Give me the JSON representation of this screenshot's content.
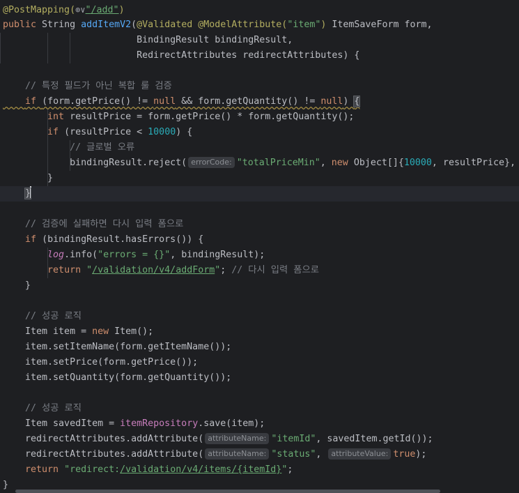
{
  "editor": {
    "lines": [
      {
        "segments": [
          {
            "t": "@PostMapping(",
            "c": "ann"
          },
          {
            "icon": "globe-icon"
          },
          {
            "t": "\"/add\"",
            "c": "url"
          },
          {
            "t": ")",
            "c": "ann"
          }
        ]
      },
      {
        "segments": [
          {
            "t": "public ",
            "c": "kw"
          },
          {
            "t": "String "
          },
          {
            "t": "addItemV2",
            "c": "fn"
          },
          {
            "t": "("
          },
          {
            "t": "@Validated @ModelAttribute(",
            "c": "ann"
          },
          {
            "t": "\"item\"",
            "c": "str"
          },
          {
            "t": ")",
            "c": "ann"
          },
          {
            "t": " ItemSaveForm form,"
          }
        ]
      },
      {
        "segments": [
          {
            "t": "                        BindingResult bindingResult,"
          }
        ]
      },
      {
        "segments": [
          {
            "t": "                        RedirectAttributes redirectAttributes) {"
          }
        ]
      },
      {
        "segments": [
          {
            "t": ""
          }
        ]
      },
      {
        "segments": [
          {
            "t": "    "
          },
          {
            "t": "// 특정 필드가 아닌 복합 룰 검증",
            "c": "cmt"
          }
        ]
      },
      {
        "warn": true,
        "segments": [
          {
            "t": "    "
          },
          {
            "t": "if ",
            "c": "kw"
          },
          {
            "t": "(form.getPrice() != "
          },
          {
            "t": "null",
            "c": "kw"
          },
          {
            "t": " && form.getQuantity() != "
          },
          {
            "t": "null",
            "c": "kw"
          },
          {
            "t": ") "
          },
          {
            "t": "{",
            "c": "brace"
          }
        ]
      },
      {
        "segments": [
          {
            "t": "        "
          },
          {
            "t": "int ",
            "c": "kw"
          },
          {
            "t": "resultPrice = form.getPrice() * form.getQuantity();"
          }
        ]
      },
      {
        "segments": [
          {
            "t": "        "
          },
          {
            "t": "if ",
            "c": "kw"
          },
          {
            "t": "(resultPrice < "
          },
          {
            "t": "10000",
            "c": "num"
          },
          {
            "t": ") {"
          }
        ]
      },
      {
        "segments": [
          {
            "t": "            "
          },
          {
            "t": "// 글로벌 오류",
            "c": "cmt"
          }
        ]
      },
      {
        "segments": [
          {
            "t": "            bindingResult.reject("
          },
          {
            "hint": "errorCode:"
          },
          {
            "t": "\"totalPriceMin\"",
            "c": "str"
          },
          {
            "t": ", "
          },
          {
            "t": "new ",
            "c": "kw"
          },
          {
            "t": "Object[]{"
          },
          {
            "t": "10000",
            "c": "num"
          },
          {
            "t": ", resultPrice},"
          }
        ]
      },
      {
        "segments": [
          {
            "t": "        }"
          }
        ]
      },
      {
        "cursor": true,
        "segments": [
          {
            "t": "    "
          },
          {
            "t": "}",
            "c": "brace"
          },
          {
            "caret": true
          }
        ]
      },
      {
        "segments": [
          {
            "t": ""
          }
        ]
      },
      {
        "segments": [
          {
            "t": "    "
          },
          {
            "t": "// 검증에 실패하면 다시 입력 폼으로",
            "c": "cmt"
          }
        ]
      },
      {
        "segments": [
          {
            "t": "    "
          },
          {
            "t": "if ",
            "c": "kw"
          },
          {
            "t": "(bindingResult.hasErrors()) {"
          }
        ]
      },
      {
        "segments": [
          {
            "t": "        "
          },
          {
            "t": "log",
            "c": "field italic"
          },
          {
            "t": ".info("
          },
          {
            "t": "\"errors = {}\"",
            "c": "str"
          },
          {
            "t": ", bindingResult);"
          }
        ]
      },
      {
        "segments": [
          {
            "t": "        "
          },
          {
            "t": "return ",
            "c": "kw"
          },
          {
            "t": "\"",
            "c": "str"
          },
          {
            "t": "/validation/v4/addForm",
            "c": "url"
          },
          {
            "t": "\"",
            "c": "str"
          },
          {
            "t": "; "
          },
          {
            "t": "// 다시 입력 폼으로",
            "c": "cmt"
          }
        ]
      },
      {
        "segments": [
          {
            "t": "    }"
          }
        ]
      },
      {
        "segments": [
          {
            "t": ""
          }
        ]
      },
      {
        "segments": [
          {
            "t": "    "
          },
          {
            "t": "// 성공 로직",
            "c": "cmt"
          }
        ]
      },
      {
        "segments": [
          {
            "t": "    Item item = "
          },
          {
            "t": "new ",
            "c": "kw"
          },
          {
            "t": "Item();"
          }
        ]
      },
      {
        "segments": [
          {
            "t": "    item.setItemName(form.getItemName());"
          }
        ]
      },
      {
        "segments": [
          {
            "t": "    item.setPrice(form.getPrice());"
          }
        ]
      },
      {
        "segments": [
          {
            "t": "    item.setQuantity(form.getQuantity());"
          }
        ]
      },
      {
        "segments": [
          {
            "t": ""
          }
        ]
      },
      {
        "segments": [
          {
            "t": "    "
          },
          {
            "t": "// 성공 로직",
            "c": "cmt"
          }
        ]
      },
      {
        "segments": [
          {
            "t": "    Item savedItem = "
          },
          {
            "t": "itemRepository",
            "c": "field"
          },
          {
            "t": ".save(item);"
          }
        ]
      },
      {
        "segments": [
          {
            "t": "    redirectAttributes.addAttribute("
          },
          {
            "hint": "attributeName:"
          },
          {
            "t": "\"itemId\"",
            "c": "str"
          },
          {
            "t": ", savedItem.getId());"
          }
        ]
      },
      {
        "segments": [
          {
            "t": "    redirectAttributes.addAttribute("
          },
          {
            "hint": "attributeName:"
          },
          {
            "t": "\"status\"",
            "c": "str"
          },
          {
            "t": ", "
          },
          {
            "hint": "attributeValue:"
          },
          {
            "t": "true",
            "c": "kw"
          },
          {
            "t": ");"
          }
        ]
      },
      {
        "segments": [
          {
            "t": "    "
          },
          {
            "t": "return ",
            "c": "kw"
          },
          {
            "t": "\"redirect:",
            "c": "str"
          },
          {
            "t": "/validation/v4/items/{itemId}",
            "c": "url"
          },
          {
            "t": "\"",
            "c": "str"
          },
          {
            "t": ";"
          }
        ]
      },
      {
        "segments": [
          {
            "t": "}"
          }
        ]
      }
    ]
  }
}
